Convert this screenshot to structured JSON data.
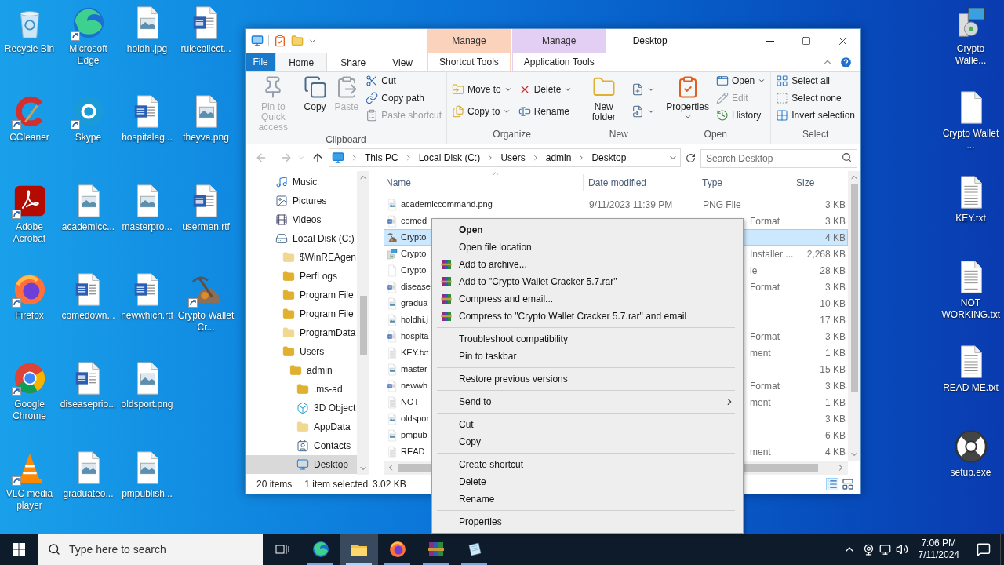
{
  "desktop": {
    "left_icons": [
      {
        "label": "Recycle Bin",
        "kind": "recycle",
        "shortcut": false
      },
      {
        "label": "CCleaner",
        "kind": "ccleaner",
        "shortcut": true
      },
      {
        "label": "Adobe Acrobat",
        "kind": "acrobat",
        "shortcut": true
      },
      {
        "label": "Firefox",
        "kind": "firefox",
        "shortcut": true
      },
      {
        "label": "Google Chrome",
        "kind": "chrome",
        "shortcut": true
      },
      {
        "label": "VLC media player",
        "kind": "vlc",
        "shortcut": true
      },
      {
        "label": "Microsoft Edge",
        "kind": "edge",
        "shortcut": true
      },
      {
        "label": "Skype",
        "kind": "skype",
        "shortcut": true
      },
      {
        "label": "academicc...",
        "kind": "image",
        "shortcut": false
      },
      {
        "label": "comedown...",
        "kind": "word",
        "shortcut": false
      },
      {
        "label": "diseaseprio...",
        "kind": "word",
        "shortcut": false
      },
      {
        "label": "graduateo...",
        "kind": "image",
        "shortcut": false
      },
      {
        "label": "holdhi.jpg",
        "kind": "image",
        "shortcut": false
      },
      {
        "label": "hospitalag...",
        "kind": "word",
        "shortcut": false
      },
      {
        "label": "masterpro...",
        "kind": "image",
        "shortcut": false
      },
      {
        "label": "newwhich.rtf",
        "kind": "word",
        "shortcut": false
      },
      {
        "label": "oldsport.png",
        "kind": "image",
        "shortcut": false
      },
      {
        "label": "pmpublish...",
        "kind": "image",
        "shortcut": false
      },
      {
        "label": "rulecollect...",
        "kind": "word",
        "shortcut": false
      },
      {
        "label": "theyva.png",
        "kind": "image",
        "shortcut": false
      },
      {
        "label": "usermen.rtf",
        "kind": "word",
        "shortcut": false
      },
      {
        "label": "Crypto Wallet Cr...",
        "kind": "crypto",
        "shortcut": true
      }
    ],
    "right_icons": [
      {
        "label": "Crypto Walle...",
        "kind": "installer",
        "shortcut": false
      },
      {
        "label": "Crypto Wallet ...",
        "kind": "blank",
        "shortcut": false
      },
      {
        "label": "KEY.txt",
        "kind": "text",
        "shortcut": false
      },
      {
        "label": "NOT WORKING.txt",
        "kind": "text",
        "shortcut": false
      },
      {
        "label": "READ ME.txt",
        "kind": "text",
        "shortcut": false
      },
      {
        "label": "setup.exe",
        "kind": "disc",
        "shortcut": false
      }
    ]
  },
  "explorer": {
    "title": "Desktop",
    "context_headers": [
      {
        "label": "Manage",
        "color": "#fbd3bd"
      },
      {
        "label": "Manage",
        "color": "#e4cff4"
      }
    ],
    "tabs": [
      {
        "label": "File",
        "kind": "file",
        "selected": false
      },
      {
        "label": "Home",
        "kind": "normal",
        "selected": true
      },
      {
        "label": "Share",
        "kind": "normal",
        "selected": false
      },
      {
        "label": "View",
        "kind": "normal",
        "selected": false
      },
      {
        "label": "Shortcut Tools",
        "kind": "context",
        "selected": false
      },
      {
        "label": "Application Tools",
        "kind": "context",
        "selected": false
      }
    ],
    "ribbon_groups": [
      {
        "label": "Clipboard",
        "large": [
          {
            "label": "Pin to Quick access",
            "kind": "pin",
            "disabled": true,
            "dropdown": false
          },
          {
            "label": "Copy",
            "kind": "copy",
            "disabled": false,
            "dropdown": false
          },
          {
            "label": "Paste",
            "kind": "paste",
            "disabled": true,
            "dropdown": false
          }
        ],
        "small_columns": [
          [
            {
              "label": "Cut",
              "kind": "cut",
              "disabled": false,
              "dropdown": false
            },
            {
              "label": "Copy path",
              "kind": "copy-path",
              "disabled": false,
              "dropdown": false
            },
            {
              "label": "Paste shortcut",
              "kind": "paste-shortcut",
              "disabled": true,
              "dropdown": false
            }
          ]
        ]
      },
      {
        "label": "Organize",
        "small_columns": [
          [
            {
              "label": "Move to",
              "kind": "move",
              "disabled": false,
              "dropdown": true
            },
            {
              "label": "Copy to",
              "kind": "copy-to",
              "disabled": false,
              "dropdown": true
            }
          ],
          [
            {
              "label": "Delete",
              "kind": "delete",
              "disabled": false,
              "dropdown": true
            },
            {
              "label": "Rename",
              "kind": "rename",
              "disabled": false,
              "dropdown": false
            }
          ]
        ]
      },
      {
        "label": "New",
        "large": [
          {
            "label": "New folder",
            "kind": "new-folder",
            "disabled": false,
            "dropdown": false
          }
        ],
        "small_columns": [
          [
            {
              "kind": "new-item",
              "disabled": false,
              "dropdown": true
            },
            {
              "kind": "easy-access",
              "disabled": false,
              "dropdown": true
            }
          ]
        ]
      },
      {
        "label": "Open",
        "large": [
          {
            "label": "Properties",
            "kind": "properties",
            "disabled": false,
            "dropdown": true
          }
        ],
        "small_columns": [
          [
            {
              "label": "Open",
              "kind": "open",
              "disabled": false,
              "dropdown": true
            },
            {
              "label": "Edit",
              "kind": "edit",
              "disabled": true,
              "dropdown": false
            },
            {
              "label": "History",
              "kind": "history",
              "disabled": false,
              "dropdown": false
            }
          ]
        ]
      },
      {
        "label": "Select",
        "small_columns": [
          [
            {
              "label": "Select all",
              "kind": "select-all",
              "disabled": false,
              "dropdown": false
            },
            {
              "label": "Select none",
              "kind": "select-none",
              "disabled": false,
              "dropdown": false
            },
            {
              "label": "Invert selection",
              "kind": "invert",
              "disabled": false,
              "dropdown": false
            }
          ]
        ]
      }
    ],
    "path": [
      "This PC",
      "Local Disk (C:)",
      "Users",
      "admin",
      "Desktop"
    ],
    "search_placeholder": "Search Desktop",
    "nav": [
      {
        "label": "Music",
        "kind": "music",
        "selected": false
      },
      {
        "label": "Pictures",
        "kind": "pictures",
        "selected": false
      },
      {
        "label": "Videos",
        "kind": "videos",
        "selected": false
      },
      {
        "label": "Local Disk (C:)",
        "kind": "drive",
        "selected": false,
        "children": [
          {
            "label": "$WinREAgen",
            "kind": "folder-faded",
            "selected": false
          },
          {
            "label": "PerfLogs",
            "kind": "folder",
            "selected": false
          },
          {
            "label": "Program File",
            "kind": "folder",
            "selected": false
          },
          {
            "label": "Program File",
            "kind": "folder",
            "selected": false
          },
          {
            "label": "ProgramData",
            "kind": "folder-faded",
            "selected": false
          },
          {
            "label": "Users",
            "kind": "folder",
            "selected": false,
            "children": [
              {
                "label": "admin",
                "kind": "folder",
                "selected": false,
                "children": [
                  {
                    "label": ".ms-ad",
                    "kind": "folder",
                    "selected": false
                  },
                  {
                    "label": "3D Object",
                    "kind": "cube",
                    "selected": false
                  },
                  {
                    "label": "AppData",
                    "kind": "folder-faded",
                    "selected": false
                  },
                  {
                    "label": "Contacts",
                    "kind": "contacts",
                    "selected": false
                  },
                  {
                    "label": "Desktop",
                    "kind": "desktop",
                    "selected": true
                  }
                ]
              }
            ]
          }
        ]
      }
    ],
    "columns": [
      "Name",
      "Date modified",
      "Type",
      "Size"
    ],
    "rows": [
      {
        "name": "academiccommand.png",
        "kind": "image",
        "date": "9/11/2023 11:39 PM",
        "type": "PNG File",
        "size": "3 KB",
        "selected": false
      },
      {
        "name": "comed",
        "kind": "word",
        "type": "Format",
        "size": "3 KB",
        "selected": false
      },
      {
        "name": "Crypto",
        "kind": "crypto",
        "size": "4 KB",
        "selected": true
      },
      {
        "name": "Crypto",
        "kind": "installer",
        "type": "Installer ...",
        "size": "2,268 KB",
        "selected": false
      },
      {
        "name": "Crypto",
        "kind": "blank",
        "type": "le",
        "size": "28 KB",
        "selected": false
      },
      {
        "name": "disease",
        "kind": "word",
        "type": "Format",
        "size": "3 KB",
        "selected": false
      },
      {
        "name": "gradua",
        "kind": "image",
        "size": "10 KB",
        "selected": false
      },
      {
        "name": "holdhi.j",
        "kind": "image",
        "size": "17 KB",
        "selected": false
      },
      {
        "name": "hospita",
        "kind": "word",
        "type": "Format",
        "size": "3 KB",
        "selected": false
      },
      {
        "name": "KEY.txt",
        "kind": "text",
        "type": "ment",
        "size": "1 KB",
        "selected": false
      },
      {
        "name": "master",
        "kind": "image",
        "size": "15 KB",
        "selected": false
      },
      {
        "name": "newwh",
        "kind": "word",
        "type": "Format",
        "size": "3 KB",
        "selected": false
      },
      {
        "name": "NOT",
        "kind": "text",
        "type": "ment",
        "size": "1 KB",
        "selected": false
      },
      {
        "name": "oldspor",
        "kind": "image",
        "size": "3 KB",
        "selected": false
      },
      {
        "name": "pmpub",
        "kind": "image",
        "size": "6 KB",
        "selected": false
      },
      {
        "name": "READ",
        "kind": "text",
        "type": "ment",
        "size": "4 KB",
        "selected": false
      }
    ],
    "status": {
      "count": "20 items",
      "selection": "1 item selected",
      "size": "3.02 KB"
    }
  },
  "context_menu": [
    {
      "kind": "item",
      "label": "Open",
      "bold": true,
      "archive_icon": false,
      "submenu": false
    },
    {
      "kind": "item",
      "label": "Open file location",
      "bold": false,
      "archive_icon": false,
      "submenu": false
    },
    {
      "kind": "item",
      "label": "Add to archive...",
      "bold": false,
      "archive_icon": true,
      "submenu": false
    },
    {
      "kind": "item",
      "label": "Add to \"Crypto Wallet Cracker 5.7.rar\"",
      "bold": false,
      "archive_icon": true,
      "submenu": false
    },
    {
      "kind": "item",
      "label": "Compress and email...",
      "bold": false,
      "archive_icon": true,
      "submenu": false
    },
    {
      "kind": "item",
      "label": "Compress to \"Crypto Wallet Cracker 5.7.rar\" and email",
      "bold": false,
      "archive_icon": true,
      "submenu": false
    },
    {
      "kind": "separator"
    },
    {
      "kind": "item",
      "label": "Troubleshoot compatibility",
      "bold": false,
      "archive_icon": false,
      "submenu": false
    },
    {
      "kind": "item",
      "label": "Pin to taskbar",
      "bold": false,
      "archive_icon": false,
      "submenu": false
    },
    {
      "kind": "separator"
    },
    {
      "kind": "item",
      "label": "Restore previous versions",
      "bold": false,
      "archive_icon": false,
      "submenu": false
    },
    {
      "kind": "separator"
    },
    {
      "kind": "item",
      "label": "Send to",
      "bold": false,
      "archive_icon": false,
      "submenu": true
    },
    {
      "kind": "separator"
    },
    {
      "kind": "item",
      "label": "Cut",
      "bold": false,
      "archive_icon": false,
      "submenu": false
    },
    {
      "kind": "item",
      "label": "Copy",
      "bold": false,
      "archive_icon": false,
      "submenu": false
    },
    {
      "kind": "separator"
    },
    {
      "kind": "item",
      "label": "Create shortcut",
      "bold": false,
      "archive_icon": false,
      "submenu": false
    },
    {
      "kind": "item",
      "label": "Delete",
      "bold": false,
      "archive_icon": false,
      "submenu": false
    },
    {
      "kind": "item",
      "label": "Rename",
      "bold": false,
      "archive_icon": false,
      "submenu": false
    },
    {
      "kind": "separator"
    },
    {
      "kind": "item",
      "label": "Properties",
      "bold": false,
      "archive_icon": false,
      "submenu": false
    }
  ],
  "taskbar": {
    "search_placeholder": "Type here to search",
    "apps": [
      {
        "kind": "task-view",
        "active": false,
        "running": false
      },
      {
        "kind": "edge",
        "active": false,
        "running": true
      },
      {
        "kind": "explorer",
        "active": true,
        "running": true
      },
      {
        "kind": "firefox",
        "active": false,
        "running": true
      },
      {
        "kind": "winrar",
        "active": false,
        "running": true
      },
      {
        "kind": "notepad",
        "active": false,
        "running": true
      }
    ],
    "time": "7:06 PM",
    "date": "7/11/2024"
  }
}
